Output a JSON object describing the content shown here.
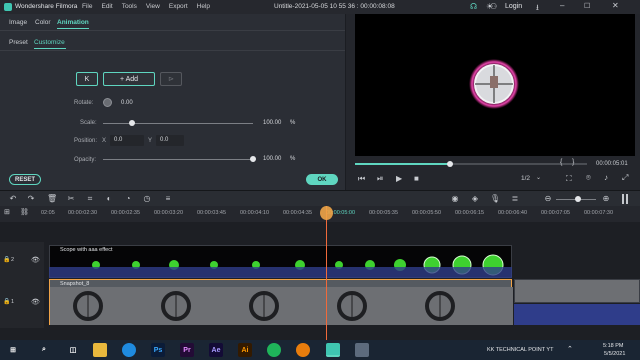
{
  "titlebar": {
    "app_name": "Wondershare Filmora",
    "menus": [
      "File",
      "Edit",
      "Tools",
      "View",
      "Export",
      "Help"
    ],
    "project_title": "Untitle-2021-05-05 10 55 36 : 00:00:08:08",
    "login_label": "Login"
  },
  "left_panel": {
    "tabs": [
      "Image",
      "Color",
      "Animation"
    ],
    "subtabs": [
      "Preset",
      "Customize"
    ],
    "add_label": "+ Add",
    "rotate": {
      "label": "Rotate:",
      "value": "0.00"
    },
    "scale": {
      "label": "Scale:",
      "value": "100.00",
      "unit": "%",
      "level": 0.19
    },
    "position": {
      "label": "Position:",
      "x_label": "X",
      "x_value": "0.0",
      "y_label": "Y",
      "y_value": "0.0"
    },
    "opacity": {
      "label": "Opacity:",
      "value": "100.00",
      "unit": "%",
      "level": 1.0
    },
    "reset_label": "RESET",
    "ok_label": "OK"
  },
  "preview": {
    "progress": 0.41,
    "page_indicator": "1/2",
    "timecode": "00:00:05:01"
  },
  "ruler": {
    "ticks": [
      "02:05",
      "00:00:02:30",
      "00:00:02:35",
      "00:00:03:20",
      "00:00:03:45",
      "00:00:04:10",
      "00:00:04:35",
      "00:00:05:00",
      "00:00:05:35",
      "00:00:05:50",
      "00:00:06:15",
      "00:00:06:40",
      "00:00:07:05",
      "00:00:07:30"
    ]
  },
  "tracks": {
    "effect_clip_label": "Scope with aaa effect",
    "video_clip_label": "Snapshot_8"
  },
  "taskbar": {
    "notification_text": "KK TECHNICAL POINT YT",
    "time": "5:18 PM",
    "date": "5/5/2021"
  }
}
